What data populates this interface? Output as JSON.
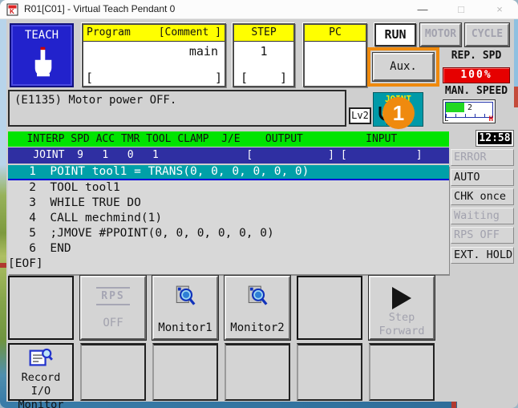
{
  "window": {
    "title": "R01[C01] - Virtual Teach Pendant 0",
    "minimize": "—",
    "maximize": "□",
    "close": "×"
  },
  "colors": {
    "accent_orange": "#ef8a0e",
    "screen_green": "#00e400",
    "selection_teal": "#00a0a8",
    "row_blue": "#2f2fa2",
    "alert_red": "#e60000",
    "teach_blue": "#2222cc",
    "header_yellow": "#ffff00"
  },
  "top": {
    "teach_label": "TEACH",
    "program_box": {
      "header": "Program",
      "comment_header": "[Comment ]",
      "value": "main",
      "bracket_left": "[",
      "bracket_right": "]"
    },
    "step_box": {
      "header": "STEP",
      "value": "1",
      "bracket_left": "[",
      "bracket_right": "]"
    },
    "pc_box": {
      "header": "PC"
    },
    "run_label": "RUN",
    "motor_label": "MOTOR",
    "cycle_label": "CYCLE",
    "aux_label": "Aux.",
    "rep_spd_label": "REP. SPD",
    "rep_spd_value": "100%",
    "man_speed_label": "MAN. SPEED",
    "speed_meter": {
      "value": "2",
      "low": "L",
      "high": "H"
    }
  },
  "message": {
    "text": "(E1135) Motor power OFF.",
    "level_badge": "Lv2",
    "joint_label": "JOINT",
    "annotation": "1"
  },
  "status_bar": {
    "header": "   INTERP SPD ACC TMR TOOL CLAMP  J/E    OUTPUT          INPUT",
    "clock": "12:58",
    "row": "    JOINT  9   1   0   1              [            ] [           ]"
  },
  "program": {
    "lines": [
      "   1  POINT tool1 = TRANS(0, 0, 0, 0, 0, 0)",
      "   2  TOOL tool1",
      "   3  WHILE TRUE DO",
      "   4  CALL mechmind(1)",
      "   5  ;JMOVE #PPOINT(0, 0, 0, 0, 0, 0)",
      "   6  END"
    ],
    "eof": "[EOF]"
  },
  "right_panel": {
    "items": [
      {
        "label": "ERROR"
      },
      {
        "label": "AUTO"
      },
      {
        "label": "CHK once"
      },
      {
        "label": "Waiting"
      },
      {
        "label": "RPS OFF"
      },
      {
        "label": "EXT. HOLD"
      }
    ]
  },
  "softkeys": {
    "rps_line1": "RPS",
    "rps_line2": "OFF",
    "monitor1": "Monitor1",
    "monitor2": "Monitor2",
    "step_line1": "Step",
    "step_line2": "Forward",
    "record_line1": "Record I/O",
    "record_line2": "Monitor"
  }
}
